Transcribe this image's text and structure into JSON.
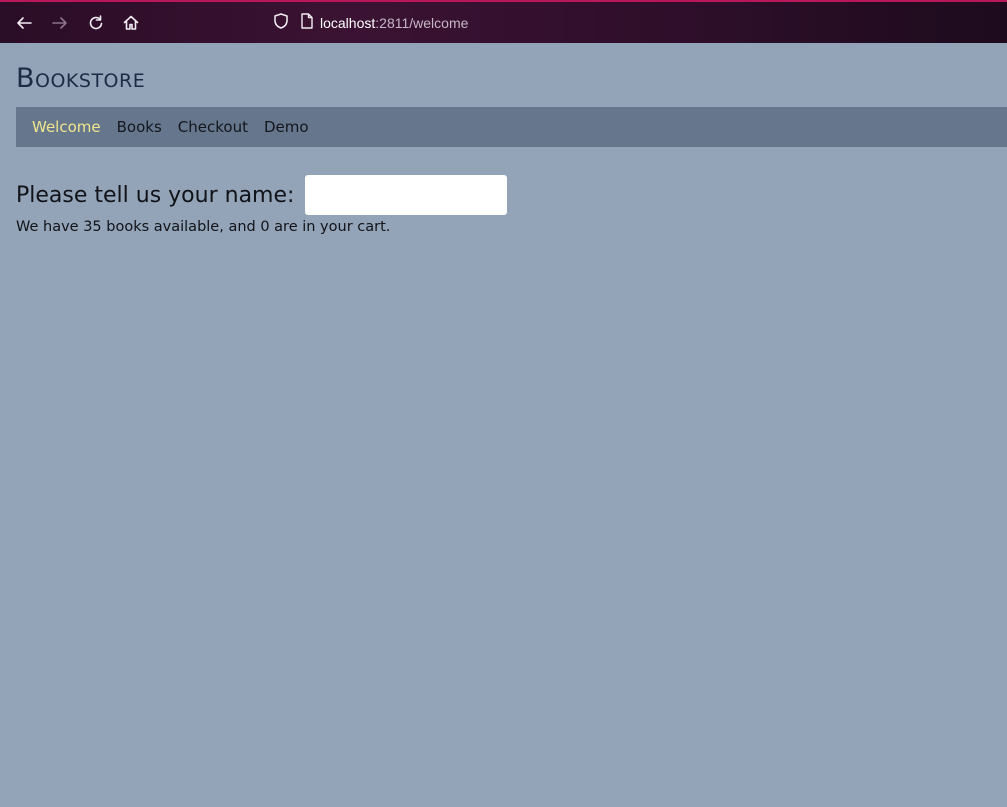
{
  "browser": {
    "url_host": "localhost",
    "url_path": ":2811/welcome",
    "icons": [
      "back-arrow-icon",
      "forward-arrow-icon",
      "reload-icon",
      "home-icon",
      "shield-icon",
      "page-icon"
    ],
    "accent_color": "#b8185a"
  },
  "site": {
    "title": "Bookstore"
  },
  "nav": {
    "items": [
      {
        "label": "Welcome",
        "active": true
      },
      {
        "label": "Books",
        "active": false
      },
      {
        "label": "Checkout",
        "active": false
      },
      {
        "label": "Demo",
        "active": false
      }
    ],
    "active_color": "#f0e68c"
  },
  "welcome": {
    "name_prompt": "Please tell us your name:",
    "name_value": "",
    "summary": "We have 35 books available, and 0 are in your cart."
  },
  "colors": {
    "page_background": "#93a3b8",
    "navbar_background": "#66768c",
    "title_color": "#1b2c45"
  }
}
